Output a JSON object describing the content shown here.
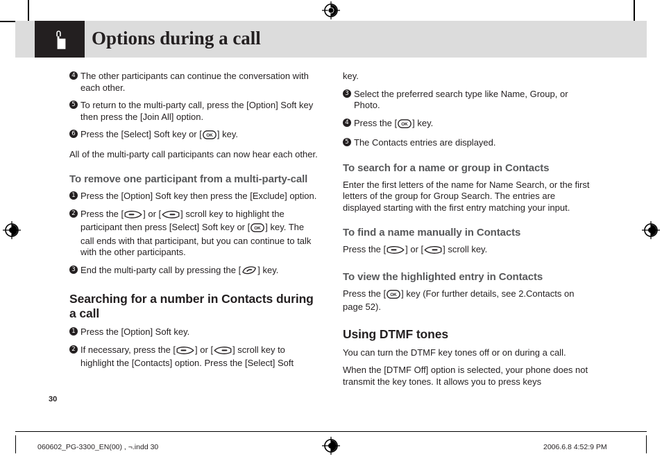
{
  "header": {
    "title": "Options during a call",
    "icon": "hand-press-icon",
    "icon_box_color": "#231f20",
    "band_color": "#dcdcdc"
  },
  "page_number": "30",
  "footer": {
    "file_name": "060602_PG-3300_EN(00) , ¬.indd   30",
    "date_time": "2006.6.8   4:52:9 PM"
  },
  "icons": {
    "ok_key": "ok-key-icon",
    "scroll_up_key": "scroll-up-key-icon",
    "scroll_down_key": "scroll-down-key-icon",
    "end_call_key": "end-call-key-icon"
  },
  "left_column": {
    "blocks": [
      {
        "kind": "step",
        "num": "4",
        "parts": [
          {
            "t": "text",
            "v": "The other participants can continue the conversation with each other."
          }
        ]
      },
      {
        "kind": "step",
        "num": "5",
        "parts": [
          {
            "t": "text",
            "v": "To return to the multi-party call, press the [Option] Soft key then press the [Join All] option."
          }
        ]
      },
      {
        "kind": "step",
        "num": "6",
        "parts": [
          {
            "t": "text",
            "v": "Press the [Select] Soft key or ["
          },
          {
            "t": "key",
            "v": "ok_key"
          },
          {
            "t": "text",
            "v": "] key."
          }
        ]
      },
      {
        "kind": "para",
        "parts": [
          {
            "t": "text",
            "v": "All of the multi-party call participants can now hear each other."
          }
        ]
      },
      {
        "kind": "h2",
        "text": "To remove one participant from a multi-party-call"
      },
      {
        "kind": "step",
        "num": "1",
        "parts": [
          {
            "t": "text",
            "v": "Press the [Option] Soft key then press the [Exclude] option."
          }
        ]
      },
      {
        "kind": "step",
        "num": "2",
        "parts": [
          {
            "t": "text",
            "v": "Press the ["
          },
          {
            "t": "key",
            "v": "scroll_up_key"
          },
          {
            "t": "text",
            "v": "] or ["
          },
          {
            "t": "key",
            "v": "scroll_down_key"
          },
          {
            "t": "text",
            "v": "] scroll key to highlight the participant then press [Select] Soft key or ["
          },
          {
            "t": "key",
            "v": "ok_key"
          },
          {
            "t": "text",
            "v": "] key. The call ends with that participant, but you can continue to talk with the other participants."
          }
        ]
      },
      {
        "kind": "step",
        "num": "3",
        "parts": [
          {
            "t": "text",
            "v": "End the multi-party call by pressing the ["
          },
          {
            "t": "key",
            "v": "end_call_key"
          },
          {
            "t": "text",
            "v": "] key."
          }
        ]
      },
      {
        "kind": "h1",
        "text": "Searching for a number in Contacts during a call"
      },
      {
        "kind": "step",
        "num": "1",
        "parts": [
          {
            "t": "text",
            "v": "Press the [Option] Soft key."
          }
        ]
      },
      {
        "kind": "step",
        "num": "2",
        "parts": [
          {
            "t": "text",
            "v": "If necessary, press the ["
          },
          {
            "t": "key",
            "v": "scroll_up_key"
          },
          {
            "t": "text",
            "v": "] or ["
          },
          {
            "t": "key",
            "v": "scroll_down_key"
          },
          {
            "t": "text",
            "v": "] scroll key to highlight the [Contacts] option. Press the [Select] Soft"
          }
        ]
      }
    ]
  },
  "right_column": {
    "blocks": [
      {
        "kind": "para-cont",
        "parts": [
          {
            "t": "text",
            "v": "key."
          }
        ]
      },
      {
        "kind": "step",
        "num": "3",
        "parts": [
          {
            "t": "text",
            "v": "Select the preferred search type like Name, Group, or Photo."
          }
        ]
      },
      {
        "kind": "step",
        "num": "4",
        "parts": [
          {
            "t": "text",
            "v": "Press the ["
          },
          {
            "t": "key",
            "v": "ok_key"
          },
          {
            "t": "text",
            "v": "] key."
          }
        ]
      },
      {
        "kind": "step",
        "num": "5",
        "parts": [
          {
            "t": "text",
            "v": "The Contacts entries are displayed."
          }
        ]
      },
      {
        "kind": "h2",
        "text": "To search for a name or group in Contacts"
      },
      {
        "kind": "para",
        "parts": [
          {
            "t": "text",
            "v": "Enter the first letters of the name for Name Search, or the first letters of the group for Group Search. The entries are displayed starting with the first entry matching your input."
          }
        ]
      },
      {
        "kind": "h2",
        "text": "To find a name manually in Contacts"
      },
      {
        "kind": "para",
        "parts": [
          {
            "t": "text",
            "v": "Press the ["
          },
          {
            "t": "key",
            "v": "scroll_up_key"
          },
          {
            "t": "text",
            "v": "] or ["
          },
          {
            "t": "key",
            "v": "scroll_down_key"
          },
          {
            "t": "text",
            "v": "] scroll key."
          }
        ]
      },
      {
        "kind": "h2",
        "text": "To view the highlighted entry in Contacts"
      },
      {
        "kind": "para",
        "parts": [
          {
            "t": "text",
            "v": "Press the ["
          },
          {
            "t": "key",
            "v": "ok_key"
          },
          {
            "t": "text",
            "v": "] key (For further details, see 2.Contacts on page 52)."
          }
        ]
      },
      {
        "kind": "h1",
        "text": "Using DTMF tones"
      },
      {
        "kind": "para",
        "parts": [
          {
            "t": "text",
            "v": "You can turn the DTMF key tones off or on during a call."
          }
        ]
      },
      {
        "kind": "para",
        "parts": [
          {
            "t": "text",
            "v": "When the [DTMF Off] option is selected, your phone does not transmit the key tones. It allows you to press keys"
          }
        ]
      }
    ]
  }
}
